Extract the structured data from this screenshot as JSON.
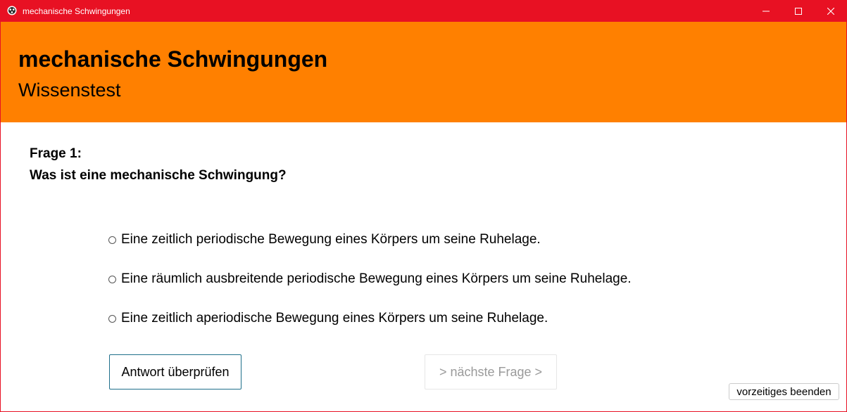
{
  "window": {
    "title": "mechanische Schwingungen",
    "icon": "app-icon",
    "controls": [
      "minimize-icon",
      "maximize-icon",
      "close-icon"
    ],
    "accent_color": "#e81123"
  },
  "header": {
    "title": "mechanische Schwingungen",
    "subtitle": "Wissenstest",
    "background_color": "#ff8000"
  },
  "question": {
    "number_label": "Frage 1:",
    "text": "Was ist eine mechanische Schwingung?"
  },
  "options": [
    {
      "label": "Eine zeitlich periodische Bewegung eines Körpers um seine Ruhelage.",
      "selected": false
    },
    {
      "label": "Eine räumlich ausbreitende periodische Bewegung eines Körpers um seine Ruhelage.",
      "selected": false
    },
    {
      "label": "Eine zeitlich aperiodische Bewegung eines Körpers um seine Ruhelage.",
      "selected": false
    }
  ],
  "buttons": {
    "check_label": "Antwort überprüfen",
    "next_label": "> nächste Frage >",
    "next_enabled": false,
    "end_label": "vorzeitiges beenden"
  }
}
